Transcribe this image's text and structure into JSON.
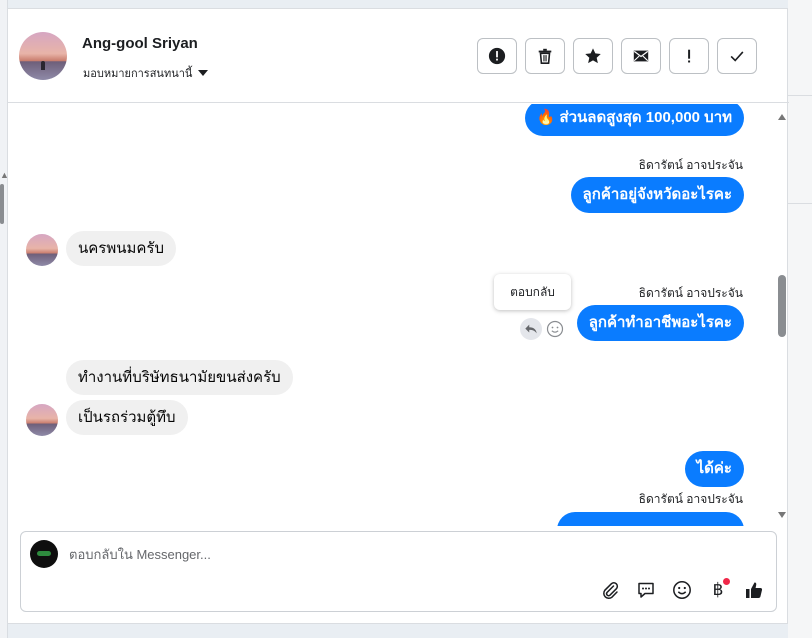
{
  "header": {
    "contact_name": "Ang-gool Sriyan",
    "assign_label": "มอบหมายการสนทนานี้"
  },
  "toolbar": {
    "buttons": [
      {
        "icon": "alert-circle-icon"
      },
      {
        "icon": "trash-icon"
      },
      {
        "icon": "star-icon"
      },
      {
        "icon": "envelope-icon"
      },
      {
        "icon": "exclamation-icon"
      },
      {
        "icon": "checkmark-icon"
      }
    ]
  },
  "messages": {
    "m1_text": "🔥 ส่วนลดสูงสุด 100,000 บาท",
    "sender_1": "ธิดารัตน์ อาจประจัน",
    "m2_text": "ลูกค้าอยู่จังหวัดอะไรคะ",
    "m3_text": "นครพนมครับ",
    "sender_2": "ธิดารัตน์ อาจประจัน",
    "m4_text": "ลูกค้าทำอาชีพอะไรคะ",
    "tooltip": "ตอบกลับ",
    "m5_text": "ทำงานที่บริษัทธนามัยขนส่งครับ",
    "m6_text": "เป็นรถร่วมตู้ทึบ",
    "m7_text": "ได้ค่ะ",
    "sender_3": "ธิดารัตน์ อาจประจัน"
  },
  "composer": {
    "placeholder": "ตอบกลับใน Messenger...",
    "value": "",
    "icons": [
      "paperclip-icon",
      "chat-bubble-icon",
      "emoji-icon",
      "baht-icon",
      "thumbs-up-icon"
    ],
    "baht_symbol": "฿"
  },
  "colors": {
    "accent": "#0a7cff",
    "incoming_bubble": "#f0f0f0",
    "notification_dot": "#f02849"
  }
}
